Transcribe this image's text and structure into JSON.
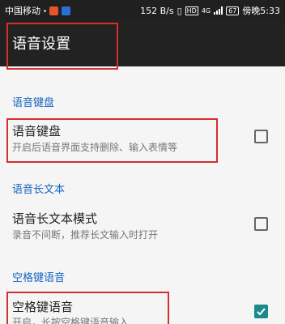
{
  "status_bar": {
    "carrier": "中国移动",
    "speed": "152 B/s",
    "hd_badge": "HD",
    "signal_type": "4G",
    "battery": "67",
    "time": "傍晚5:33"
  },
  "toolbar": {
    "title": "语音设置"
  },
  "sections": [
    {
      "header": "语音键盘",
      "item": {
        "title": "语音键盘",
        "subtitle": "开启后语音界面支持删除、输入表情等",
        "checked": false
      }
    },
    {
      "header": "语音长文本",
      "item": {
        "title": "语音长文本模式",
        "subtitle": "录音不间断，推荐长文输入时打开",
        "checked": false
      }
    },
    {
      "header": "空格键语音",
      "item": {
        "title": "空格键语音",
        "subtitle": "开启，长按空格键语音输入",
        "checked": true
      }
    }
  ],
  "colors": {
    "accent": "#1565c0",
    "checkbox_checked": "#1b8a8a",
    "highlight_box": "#d32f2f"
  }
}
